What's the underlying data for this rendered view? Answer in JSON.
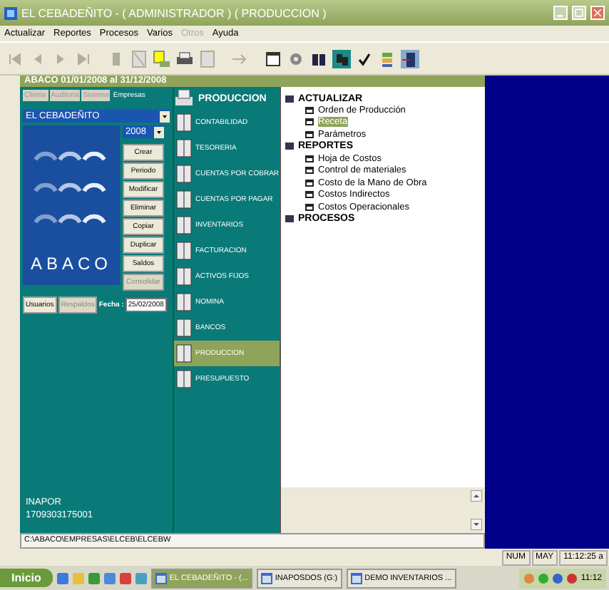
{
  "window": {
    "title": "EL CEBADEÑITO - ( ADMINISTRADOR ) ( PRODUCCION )"
  },
  "menu": [
    {
      "label": "Actualizar",
      "disabled": false
    },
    {
      "label": "Reportes",
      "disabled": false
    },
    {
      "label": "Procesos",
      "disabled": false
    },
    {
      "label": "Varios",
      "disabled": false
    },
    {
      "label": "Otros",
      "disabled": true
    },
    {
      "label": "Ayuda",
      "disabled": false
    }
  ],
  "period_bar": {
    "text": "ABACO  01/01/2008 al 31/12/2008"
  },
  "company_panel": {
    "tabs": [
      {
        "label": "Cliente",
        "selected": false
      },
      {
        "label": "Auditoria",
        "selected": false
      },
      {
        "label": "Sistema",
        "selected": false
      },
      {
        "label": "Empresas",
        "selected": true
      }
    ],
    "company": "EL CEBADEÑITO",
    "year": "2008",
    "logo": "ABACO",
    "buttons": [
      {
        "label": "Crear",
        "disabled": false
      },
      {
        "label": "Periodo",
        "disabled": false
      },
      {
        "label": "Modificar",
        "disabled": false
      },
      {
        "label": "Eliminar",
        "disabled": false
      },
      {
        "label": "Copiar",
        "disabled": false
      },
      {
        "label": "Duplicar",
        "disabled": false
      },
      {
        "label": "Saldos",
        "disabled": false
      },
      {
        "label": "Consolidar",
        "disabled": true
      }
    ],
    "footer_buttons": [
      {
        "label": "Usuarios",
        "disabled": false
      },
      {
        "label": "Respaldos",
        "disabled": true
      }
    ],
    "date_label": "Fecha :",
    "date": "25/02/2008",
    "user": "INAPOR",
    "id_number": "1709303175001"
  },
  "modules": {
    "header": "PRODUCCION",
    "items": [
      {
        "label": "CONTABILIDAD",
        "selected": false
      },
      {
        "label": "TESORERIA",
        "selected": false
      },
      {
        "label": "CUENTAS POR COBRAR",
        "selected": false
      },
      {
        "label": "CUENTAS POR PAGAR",
        "selected": false
      },
      {
        "label": "INVENTARIOS",
        "selected": false
      },
      {
        "label": "FACTURACION",
        "selected": false
      },
      {
        "label": "ACTIVOS FIJOS",
        "selected": false
      },
      {
        "label": "NOMINA",
        "selected": false
      },
      {
        "label": "BANCOS",
        "selected": false
      },
      {
        "label": "PRODUCCION",
        "selected": true
      },
      {
        "label": "PRESUPUESTO",
        "selected": false
      }
    ]
  },
  "tree": [
    {
      "label": "ACTUALIZAR",
      "children": [
        {
          "label": "Orden de Producción",
          "selected": false
        },
        {
          "label": "Receta",
          "selected": true
        },
        {
          "label": "Parámetros",
          "selected": false
        }
      ]
    },
    {
      "label": "REPORTES",
      "children": [
        {
          "label": "Hoja de Costos",
          "selected": false
        },
        {
          "label": "Control de materiales",
          "selected": false
        },
        {
          "label": "Costo de la Mano de Obra",
          "selected": false
        },
        {
          "label": "Costos Indirectos",
          "selected": false
        },
        {
          "label": "Costos Operacionales",
          "selected": false
        }
      ]
    },
    {
      "label": "PROCESOS"
    }
  ],
  "path": "C:\\ABACO\\EMPRESAS\\ELCEB\\ELCEBW",
  "status_bar": [
    "NUM",
    "MAY",
    "11:12:25 a"
  ],
  "taskbar": {
    "start": "Inicio",
    "tasks": [
      {
        "label": "EL CEBADEÑITO - (...",
        "selected": true
      },
      {
        "label": "INAPOSDOS (G:)",
        "selected": false
      },
      {
        "label": "DEMO INVENTARIOS ...",
        "selected": false
      }
    ],
    "clock": "11:12"
  }
}
